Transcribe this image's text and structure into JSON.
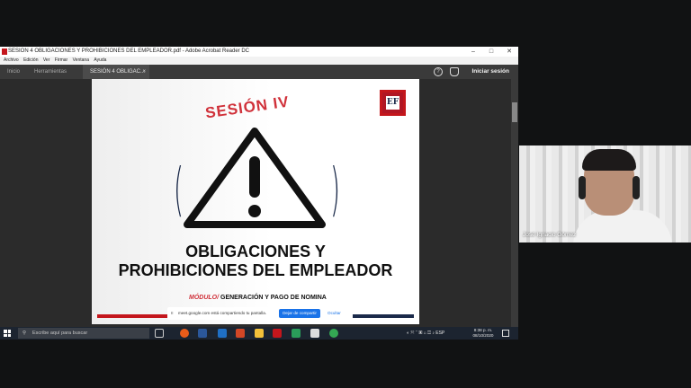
{
  "window": {
    "title": "SESION 4 OBLIGACIONES Y PROHIBICIONES DEL EMPLEADOR.pdf - Adobe Acrobat Reader DC",
    "controls": [
      "–",
      "□",
      "✕"
    ]
  },
  "menu": [
    "Archivo",
    "Edición",
    "Ver",
    "Firmar",
    "Ventana",
    "Ayuda"
  ],
  "tabs": {
    "home": "Inicio",
    "tools": "Herramientas",
    "document": "SESIÓN 4 OBLIGAC...",
    "close": "×"
  },
  "header": {
    "signin": "Iniciar sesión",
    "help_icon": "?",
    "bell_icon": "bell-icon"
  },
  "slide": {
    "session": "SESIÓN IV",
    "logo": "EF",
    "heading_line1": "OBLIGACIONES Y",
    "heading_line2": "PROHIBICIONES DEL EMPLEADOR",
    "module_label": "MÓDULO/",
    "module_value": "GENERACIÓN Y PAGO DE NOMINA",
    "colors": {
      "red": "#c4161c",
      "navy": "#1b2a4a"
    }
  },
  "share_bar": {
    "pause": "II",
    "message": "meet.google.com está compartiendo tu pantalla.",
    "stop_button": "Dejar de compartir",
    "hide_button": "Ocultar"
  },
  "taskbar": {
    "search_placeholder": "Escribe aquí para buscar",
    "tray_lang": "ESP",
    "time": "8:38 p. m.",
    "date": "08/10/2020"
  },
  "participant": {
    "name": "José Ignacio Gómez"
  }
}
